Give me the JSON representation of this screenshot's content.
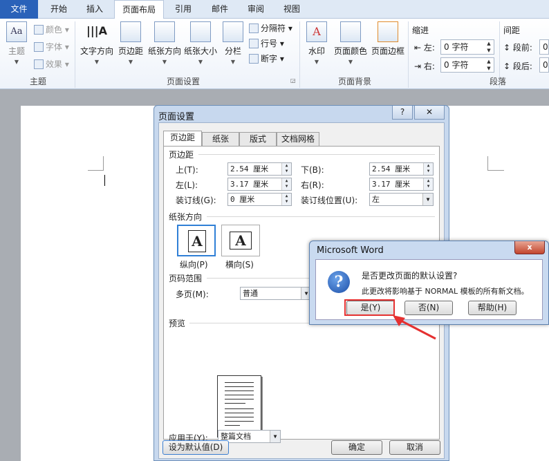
{
  "ribbon": {
    "tabs": [
      "文件",
      "开始",
      "插入",
      "页面布局",
      "引用",
      "邮件",
      "审阅",
      "视图"
    ],
    "theme_group": {
      "label": "主题",
      "big_button": "主题",
      "items": [
        "颜色",
        "字体",
        "效果"
      ]
    },
    "page_setup_group": {
      "label": "页面设置",
      "buttons": [
        "文字方向",
        "页边距",
        "纸张方向",
        "纸张大小",
        "分栏"
      ],
      "small": [
        "分隔符",
        "行号",
        "断字"
      ]
    },
    "background_group": {
      "label": "页面背景",
      "buttons": [
        "水印",
        "页面颜色",
        "页面边框"
      ]
    },
    "paragraph_group": {
      "label": "段落",
      "indent_title": "缩进",
      "indent_left_label": "左:",
      "indent_left_value": "0 字符",
      "indent_right_label": "右:",
      "indent_right_value": "0 字符",
      "spacing_title": "间距",
      "space_before_label": "段前:",
      "space_before_value": "0",
      "space_after_label": "段后:",
      "space_after_value": "0"
    }
  },
  "dialog": {
    "title": "页面设置",
    "help": "?",
    "tabs": [
      "页边距",
      "纸张",
      "版式",
      "文档网格"
    ],
    "margins_section": "页边距",
    "top_label": "上(T):",
    "top_value": "2.54 厘米",
    "bottom_label": "下(B):",
    "bottom_value": "2.54 厘米",
    "left_label": "左(L):",
    "left_value": "3.17 厘米",
    "right_label": "右(R):",
    "right_value": "3.17 厘米",
    "gutter_label": "装订线(G):",
    "gutter_value": "0 厘米",
    "gutter_pos_label": "装订线位置(U):",
    "gutter_pos_value": "左",
    "orientation_section": "纸张方向",
    "portrait": "纵向(P)",
    "landscape": "横向(S)",
    "pages_section": "页码范围",
    "multiple_pages_label": "多页(M):",
    "multiple_pages_value": "普通",
    "preview_section": "预览",
    "apply_to_label": "应用于(Y):",
    "apply_to_value": "整篇文档",
    "set_default": "设为默认值(D)",
    "ok": "确定",
    "cancel": "取消"
  },
  "prompt": {
    "title": "Microsoft Word",
    "close": "x",
    "question": "是否更改页面的默认设置?",
    "detail": "此更改将影响基于 NORMAL 模板的所有新文档。",
    "yes": "是(Y)",
    "no": "否(N)",
    "help": "帮助(H)"
  },
  "colors": {
    "file_tab": "#2a62b9",
    "highlight": "#e53030"
  }
}
